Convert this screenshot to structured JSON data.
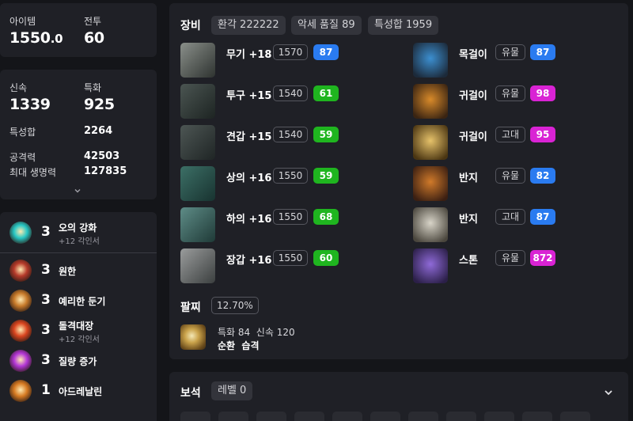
{
  "stats_top": {
    "item_level_label": "아이템",
    "item_level_value": "1550",
    "item_level_decimal": ".0",
    "combat_label": "전투",
    "combat_value": "60"
  },
  "stats_combat": {
    "swiftness_label": "신속",
    "swiftness_value": "1339",
    "specialization_label": "특화",
    "specialization_value": "925",
    "total_label": "특성합",
    "total_value": "2264",
    "attack_label": "공격력",
    "attack_value": "42503",
    "hp_label": "최대 생명력",
    "hp_value": "127835"
  },
  "engravings": [
    {
      "level": "3",
      "name": "오의 강화",
      "sub": "+12 각인서",
      "icon": "blue-orb-icon",
      "color": "#27c7c4"
    },
    {
      "level": "3",
      "name": "원한",
      "sub": "",
      "icon": "grudge-icon",
      "color": "#b53a2a"
    },
    {
      "level": "3",
      "name": "예리한 둔기",
      "sub": "",
      "icon": "keen-blunt-icon",
      "color": "#c77a2a"
    },
    {
      "level": "3",
      "name": "돌격대장",
      "sub": "+12 각인서",
      "icon": "raid-captain-icon",
      "color": "#d9451f"
    },
    {
      "level": "3",
      "name": "질량 증가",
      "sub": "",
      "icon": "mass-increase-icon",
      "color": "#b336d6"
    },
    {
      "level": "1",
      "name": "아드레날린",
      "sub": "",
      "icon": "adrenaline-icon",
      "color": "#d67a22"
    }
  ],
  "equipment": {
    "title": "장비",
    "tags": [
      "환각 222222",
      "악세 품질 89",
      "특성합 1959"
    ],
    "armor": [
      {
        "name": "무기 +18",
        "level": "1570",
        "quality": "87",
        "quality_color": "#2a7bf0",
        "icon": "weapon-icon"
      },
      {
        "name": "투구 +15",
        "level": "1540",
        "quality": "61",
        "quality_color": "#1fb51f",
        "icon": "helmet-icon"
      },
      {
        "name": "견갑 +15",
        "level": "1540",
        "quality": "59",
        "quality_color": "#1fb51f",
        "icon": "shoulder-icon"
      },
      {
        "name": "상의 +16",
        "level": "1550",
        "quality": "59",
        "quality_color": "#1fb51f",
        "icon": "chest-icon"
      },
      {
        "name": "하의 +16",
        "level": "1550",
        "quality": "68",
        "quality_color": "#1fb51f",
        "icon": "pants-icon"
      },
      {
        "name": "장갑 +16",
        "level": "1550",
        "quality": "60",
        "quality_color": "#1fb51f",
        "icon": "gloves-icon"
      }
    ],
    "accessories": [
      {
        "name": "목걸이",
        "grade": "유물",
        "quality": "87",
        "quality_color": "#2a7bf0",
        "icon": "necklace-icon"
      },
      {
        "name": "귀걸이",
        "grade": "유물",
        "quality": "98",
        "quality_color": "#d923d4",
        "icon": "earring-icon"
      },
      {
        "name": "귀걸이",
        "grade": "고대",
        "quality": "95",
        "quality_color": "#d923d4",
        "icon": "earring-icon"
      },
      {
        "name": "반지",
        "grade": "유물",
        "quality": "82",
        "quality_color": "#2a7bf0",
        "icon": "ring-icon"
      },
      {
        "name": "반지",
        "grade": "고대",
        "quality": "87",
        "quality_color": "#2a7bf0",
        "icon": "ring-icon"
      },
      {
        "name": "스톤",
        "grade": "유물",
        "quality": "872",
        "quality_color": "#d923d4",
        "icon": "stone-icon"
      }
    ]
  },
  "bracelet": {
    "title": "팔찌",
    "percent": "12.70%",
    "line1": "특화 84  신속 120",
    "line2": "순환  습격"
  },
  "gems": {
    "title": "보석",
    "level_tag": "레벨 0"
  }
}
